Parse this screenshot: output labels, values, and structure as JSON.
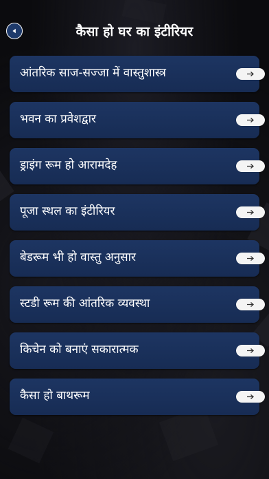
{
  "header": {
    "title": "कैसा हो घर का इंटीरियर",
    "back_icon": "chevron-left-icon"
  },
  "colors": {
    "background": "#0b0b0e",
    "card": "#1b325e",
    "back_button": "#1e3a6b",
    "arrow_pill": "#f4f4f4",
    "text": "#ffffff"
  },
  "menu": {
    "items": [
      {
        "label": "आंतरिक साज-सज्जा में वास्तुशास्त्र",
        "icon": "arrow-right-icon"
      },
      {
        "label": "भवन का प्रवेशद्वार",
        "icon": "arrow-right-icon"
      },
      {
        "label": "ड्राइंग रूम हो आरामदेह",
        "icon": "arrow-right-icon"
      },
      {
        "label": "पूजा स्थल का इंटीरियर",
        "icon": "arrow-right-icon"
      },
      {
        "label": "बेडरूम भी हो वास्तु अनुसार",
        "icon": "arrow-right-icon"
      },
      {
        "label": "स्टडी रूम की आंतरिक व्यवस्था",
        "icon": "arrow-right-icon"
      },
      {
        "label": "किचेन को बनाएं सकारात्मक",
        "icon": "arrow-right-icon"
      },
      {
        "label": "कैसा हो बाथरूम",
        "icon": "arrow-right-icon"
      }
    ]
  }
}
